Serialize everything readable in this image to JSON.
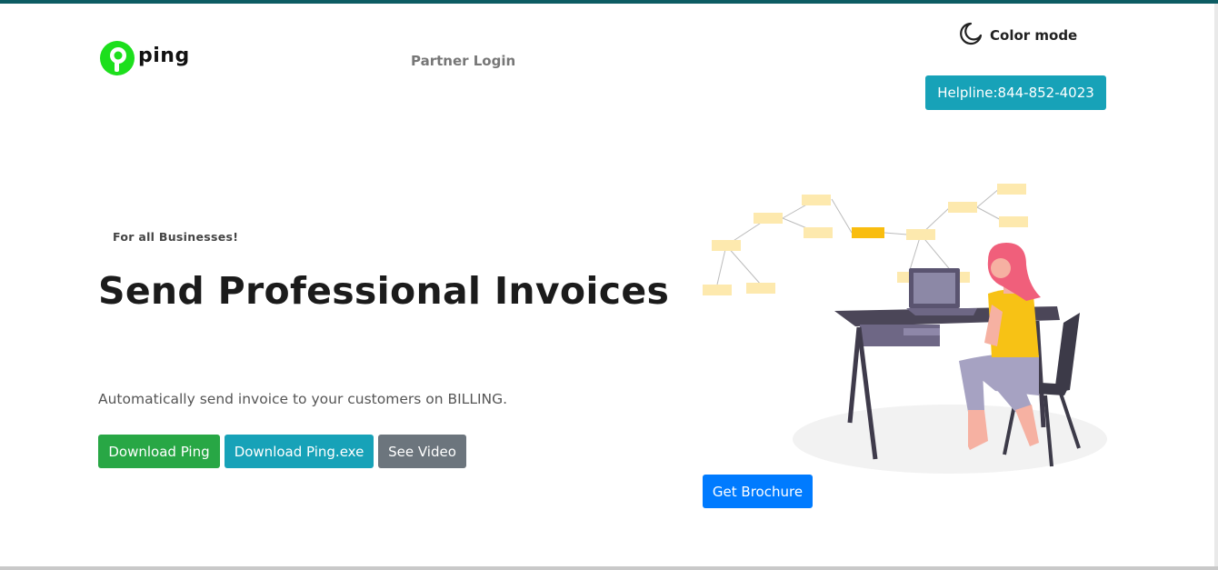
{
  "header": {
    "logo_text": "ping",
    "partner_login": "Partner Login",
    "color_mode": "Color mode",
    "helpline": "Helpline:844-852-4023"
  },
  "hero": {
    "tag": "For all Businesses!",
    "headline": "Send Professional Invoices",
    "subtext": "Automatically send invoice to your customers on BILLING.",
    "buttons": {
      "download_ping": "Download Ping",
      "download_exe": "Download Ping.exe",
      "see_video": "See Video"
    },
    "brochure": "Get Brochure"
  },
  "colors": {
    "accent_top": "#0d5c63",
    "logo_green": "#1ddf1d",
    "green": "#28a745",
    "cyan": "#17a2b8",
    "gray": "#6c757d",
    "blue": "#007bff"
  }
}
